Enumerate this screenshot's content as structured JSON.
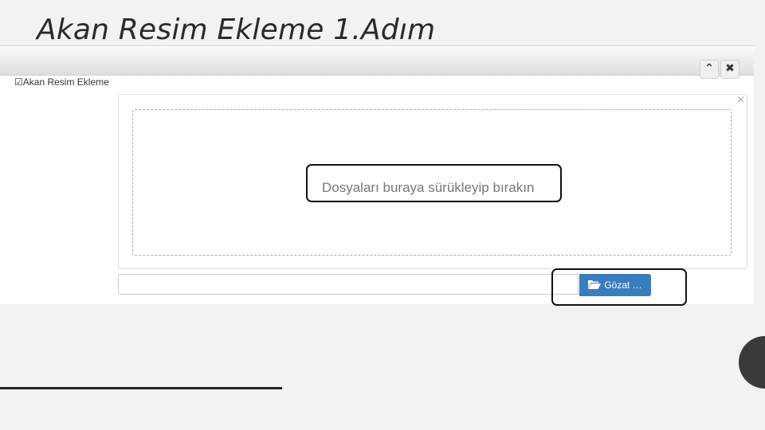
{
  "slide": {
    "title": "Akan Resim Ekleme 1.Adım"
  },
  "panel": {
    "collapse_icon": "chevron-up-icon",
    "close_icon": "close-icon",
    "collapse_glyph": "⌃",
    "close_glyph": "✖"
  },
  "widget": {
    "title_icon": "edit-icon",
    "title_glyph": "☑",
    "title": "Akan Resim Ekleme"
  },
  "upload": {
    "close_glyph": "×",
    "drop_text": "Dosyaları buraya sürükleyip bırakın",
    "filename_value": "",
    "browse_icon": "folder-open-icon",
    "browse_label": "Gözat …"
  },
  "colors": {
    "browse_button": "#3a7dbd",
    "highlight_border": "#111111",
    "slide_background": "#f2f2f2"
  }
}
